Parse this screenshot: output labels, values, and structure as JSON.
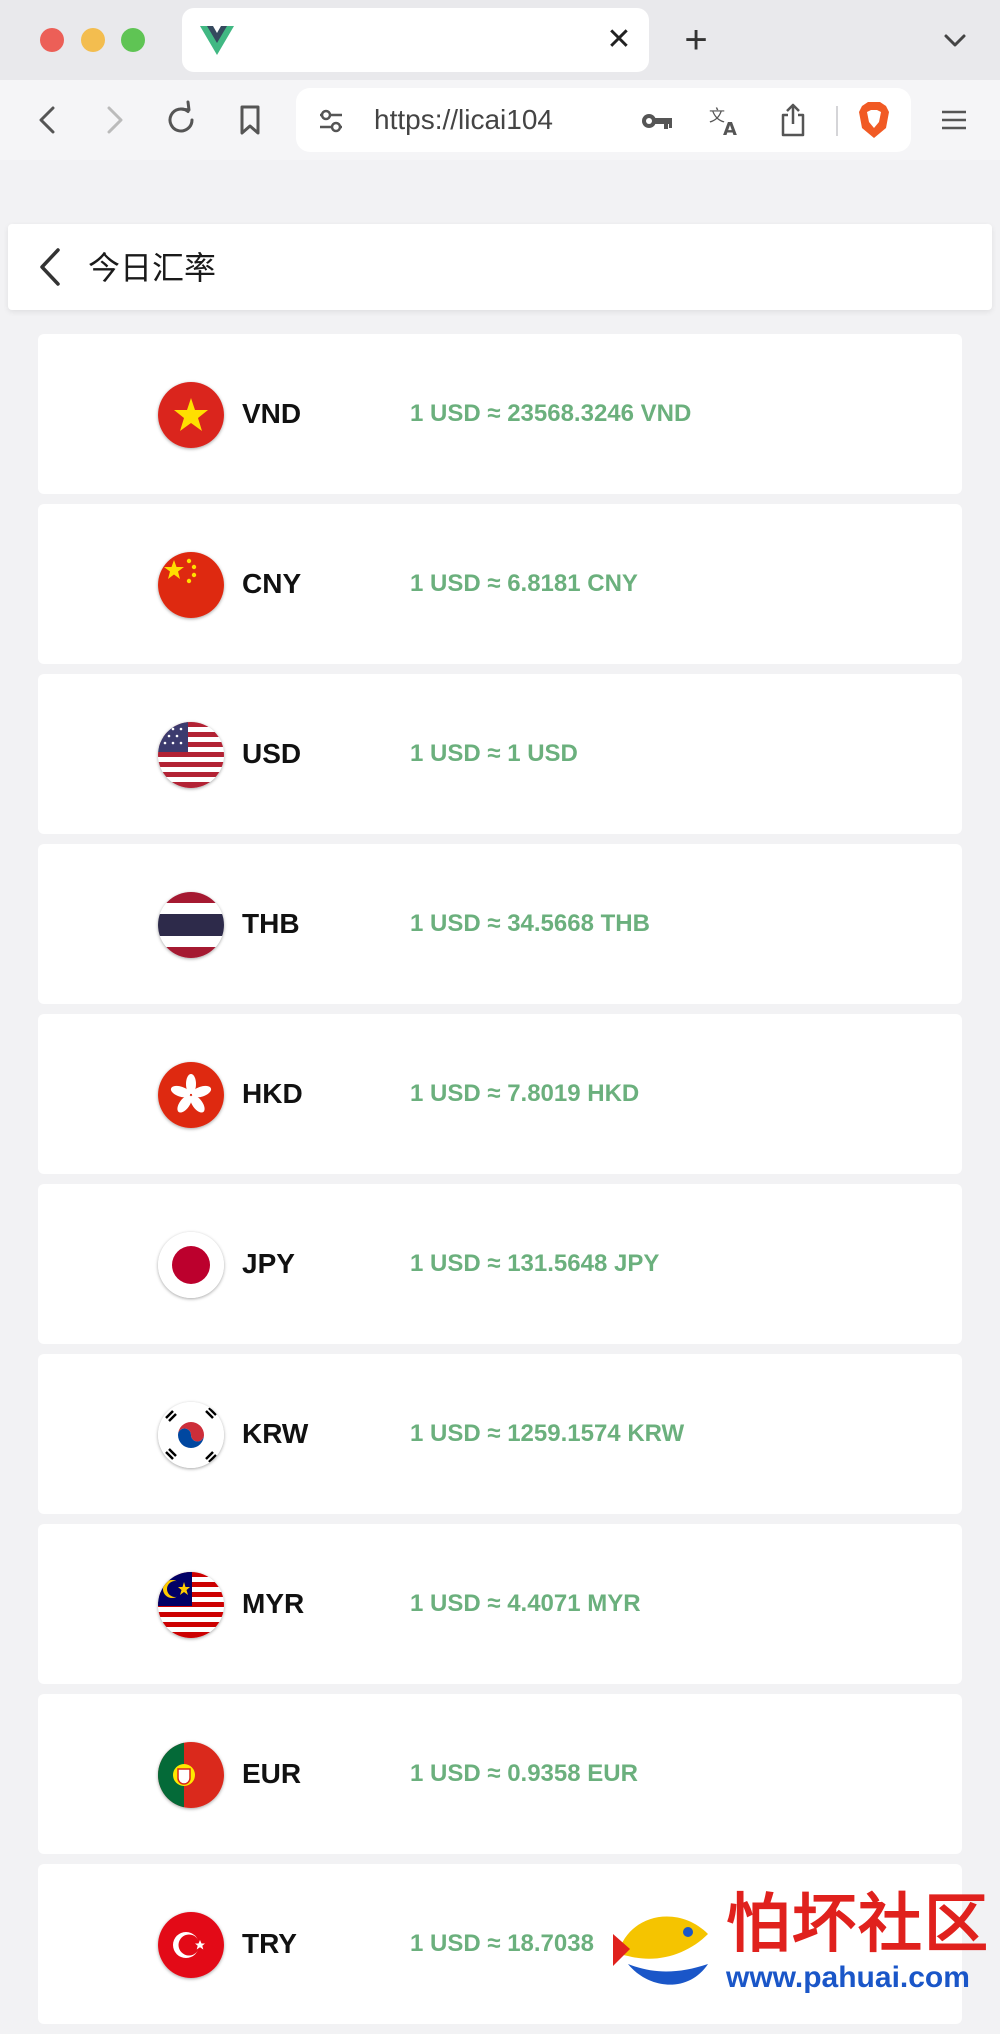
{
  "browser": {
    "url": "https://licai104",
    "tab_close": "✕",
    "new_tab": "+"
  },
  "page": {
    "title": "今日汇率"
  },
  "rates": [
    {
      "code": "VND",
      "text": "1 USD ≈ 23568.3246 VND",
      "flag": "vietnam-flag-icon"
    },
    {
      "code": "CNY",
      "text": "1 USD ≈ 6.8181 CNY",
      "flag": "china-flag-icon"
    },
    {
      "code": "USD",
      "text": "1 USD ≈ 1 USD",
      "flag": "usa-flag-icon"
    },
    {
      "code": "THB",
      "text": "1 USD ≈ 34.5668 THB",
      "flag": "thailand-flag-icon"
    },
    {
      "code": "HKD",
      "text": "1 USD ≈ 7.8019 HKD",
      "flag": "hongkong-flag-icon"
    },
    {
      "code": "JPY",
      "text": "1 USD ≈ 131.5648 JPY",
      "flag": "japan-flag-icon"
    },
    {
      "code": "KRW",
      "text": "1 USD ≈ 1259.1574 KRW",
      "flag": "korea-flag-icon"
    },
    {
      "code": "MYR",
      "text": "1 USD ≈ 4.4071 MYR",
      "flag": "malaysia-flag-icon"
    },
    {
      "code": "EUR",
      "text": "1 USD ≈ 0.9358 EUR",
      "flag": "portugal-flag-icon"
    },
    {
      "code": "TRY",
      "text": "1 USD ≈ 18.7038",
      "flag": "turkey-flag-icon"
    }
  ],
  "watermark": {
    "title": "怕坏社区",
    "url": "www.pahuai.com"
  },
  "colors": {
    "rate_text": "#6bb07d",
    "watermark_red": "#e0211d",
    "watermark_blue": "#1a56c8"
  }
}
